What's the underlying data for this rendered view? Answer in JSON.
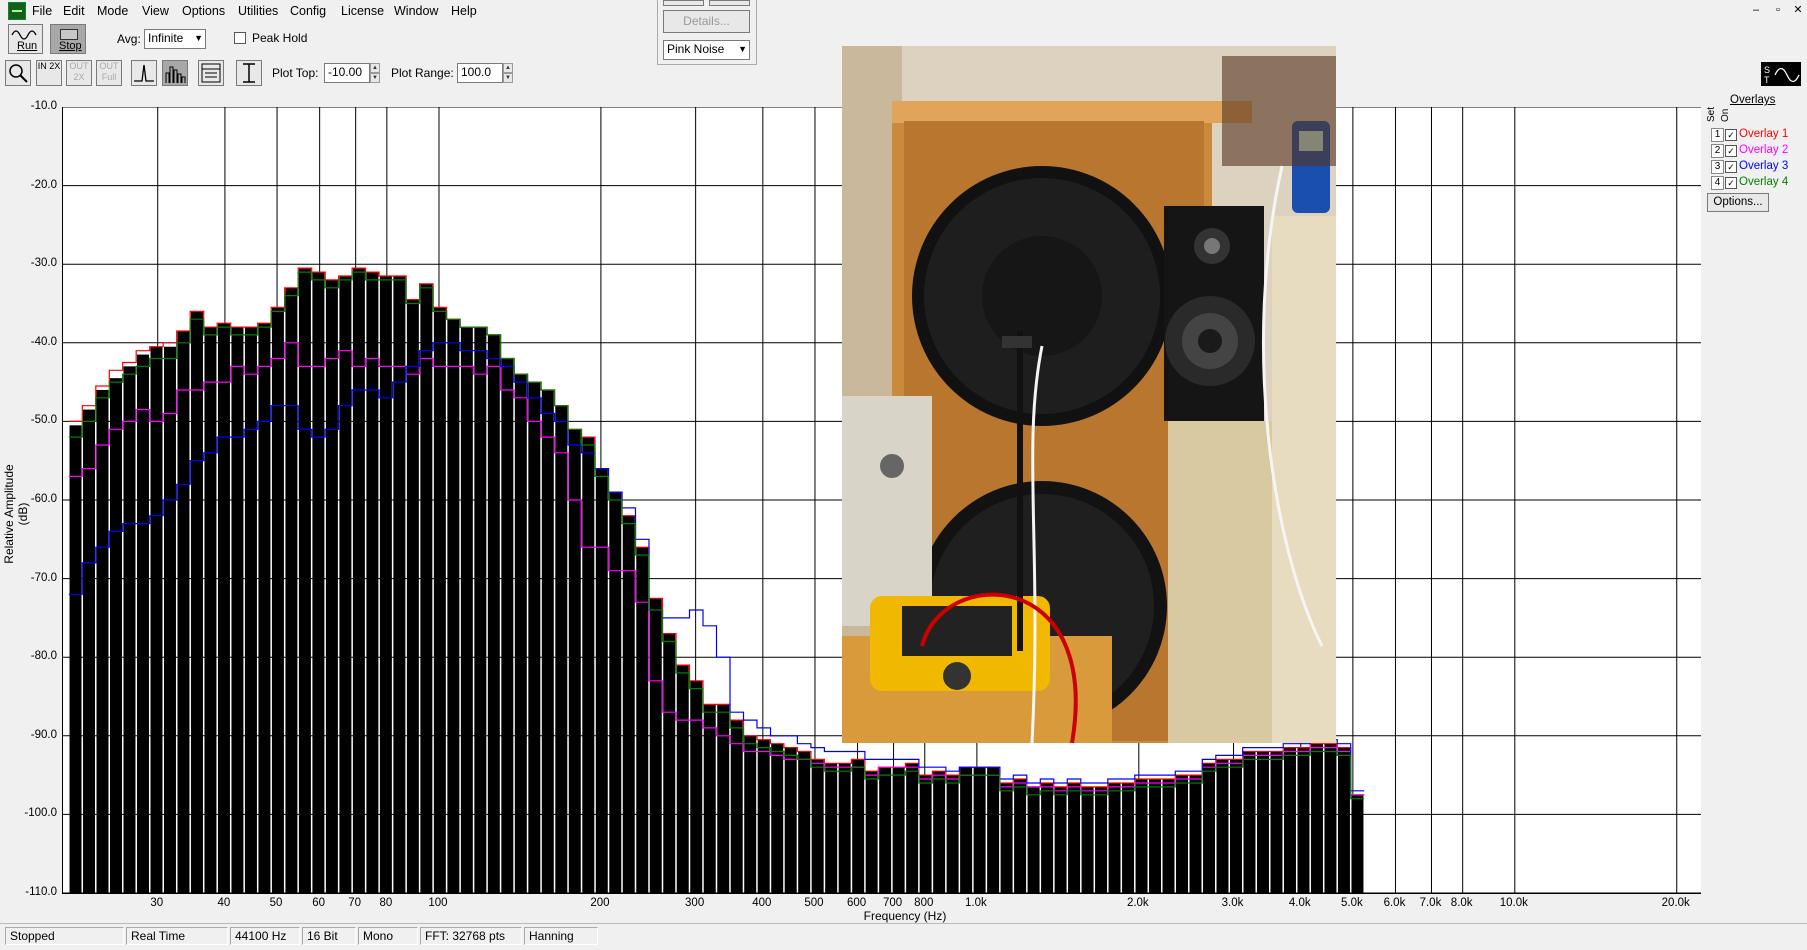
{
  "menu": [
    "File",
    "Edit",
    "Mode",
    "View",
    "Options",
    "Utilities",
    "Config",
    "License",
    "Window",
    "Help"
  ],
  "window_controls": [
    "–",
    "▫",
    "✕"
  ],
  "toolbar": {
    "run_label": "Run",
    "stop_label": "Stop",
    "avg_label": "Avg:",
    "avg_value": "Infinite",
    "peak_hold_label": "Peak Hold",
    "plot_top_label": "Plot Top:",
    "plot_top_value": "-10.00",
    "plot_range_label": "Plot Range:",
    "plot_range_value": "100.0",
    "details_label": "Details...",
    "generator_value": "Pink Noise",
    "zoom_buttons": [
      "IN 2X",
      "OUT 2X",
      "OUT Full"
    ]
  },
  "overlays": {
    "header": "Overlays",
    "set_label": "Set",
    "on_label": "On",
    "options_label": "Options...",
    "items": [
      {
        "num": "1",
        "name": "Overlay 1",
        "color": "#ff0000"
      },
      {
        "num": "2",
        "name": "Overlay 2",
        "color": "#ff00ff"
      },
      {
        "num": "3",
        "name": "Overlay 3",
        "color": "#0000ff"
      },
      {
        "num": "4",
        "name": "Overlay 4",
        "color": "#008000"
      }
    ]
  },
  "status": [
    "Stopped",
    "Real Time",
    "44100 Hz",
    "16 Bit",
    "Mono",
    "FFT: 32768 pts",
    "Hanning"
  ],
  "chart_data": {
    "type": "bar",
    "xlabel": "Frequency (Hz)",
    "ylabel": "Relative Amplitude (dB)",
    "ylim": [
      -110,
      -10
    ],
    "y_ticks": [
      "-10.0",
      "-20.0",
      "-30.0",
      "-40.0",
      "-50.0",
      "-60.0",
      "-70.0",
      "-80.0",
      "-90.0",
      "-100.0",
      "-110.0"
    ],
    "x_scale": "log",
    "x_ticks": [
      {
        "v": 30,
        "label": "30"
      },
      {
        "v": 40,
        "label": "40"
      },
      {
        "v": 50,
        "label": "50"
      },
      {
        "v": 60,
        "label": "60"
      },
      {
        "v": 70,
        "label": "70"
      },
      {
        "v": 80,
        "label": "80"
      },
      {
        "v": 100,
        "label": "100"
      },
      {
        "v": 200,
        "label": "200"
      },
      {
        "v": 300,
        "label": "300"
      },
      {
        "v": 400,
        "label": "400"
      },
      {
        "v": 500,
        "label": "500"
      },
      {
        "v": 600,
        "label": "600"
      },
      {
        "v": 700,
        "label": "700"
      },
      {
        "v": 800,
        "label": "800"
      },
      {
        "v": 1000,
        "label": "1.0k"
      },
      {
        "v": 2000,
        "label": "2.0k"
      },
      {
        "v": 3000,
        "label": "3.0k"
      },
      {
        "v": 4000,
        "label": "4.0k"
      },
      {
        "v": 5000,
        "label": "5.0k"
      },
      {
        "v": 6000,
        "label": "6.0k"
      },
      {
        "v": 7000,
        "label": "7.0k"
      },
      {
        "v": 8000,
        "label": "8.0k"
      },
      {
        "v": 10000,
        "label": "10.0k"
      },
      {
        "v": 20000,
        "label": "20.0k"
      }
    ],
    "grid": true,
    "bands_per_octave": 12,
    "bars_start_hz": 20.5,
    "values": [
      -50.5,
      -48.5,
      -46,
      -44.5,
      -43,
      -41.5,
      -40.5,
      -40.5,
      -38.5,
      -36,
      -38,
      -37.5,
      -38,
      -38,
      -37.5,
      -35.5,
      -33,
      -30.5,
      -31,
      -32,
      -31.5,
      -30.5,
      -31,
      -31.5,
      -31.5,
      -34.5,
      -32.5,
      -35.5,
      -37,
      -38,
      -38,
      -39,
      -42,
      -44,
      -45,
      -46,
      -48,
      -51,
      -52,
      -56,
      -59,
      -62,
      -66,
      -72.5,
      -77,
      -81,
      -83,
      -86,
      -86,
      -88,
      -90,
      -90.5,
      -91,
      -91.5,
      -92,
      -93,
      -93.5,
      -93.5,
      -93,
      -94.5,
      -94,
      -94,
      -93.5,
      -95,
      -94.5,
      -95,
      -94,
      -94,
      -94,
      -96,
      -95.5,
      -96.5,
      -96,
      -96.5,
      -96,
      -96.5,
      -96.5,
      -96,
      -96,
      -95.5,
      -95.5,
      -95.5,
      -95,
      -95,
      -93.5,
      -93,
      -93,
      -92,
      -92,
      -92,
      -91.5,
      -91.5,
      -91,
      -91,
      -91.5,
      -97.5
    ],
    "series": [
      {
        "name": "Overlay 1",
        "color": "#ff0000",
        "values": [
          -50,
          -48,
          -45.5,
          -43.5,
          -42.5,
          -41,
          -40.5,
          -40,
          -38.5,
          -36,
          -38,
          -37.5,
          -38,
          -38,
          -37.5,
          -35.5,
          -33,
          -30.5,
          -31,
          -32,
          -31.5,
          -30.5,
          -31,
          -31.5,
          -31.5,
          -34.5,
          -32.5,
          -35.5,
          -37,
          -38,
          -38,
          -39,
          -42,
          -44,
          -45,
          -46,
          -48,
          -51,
          -52,
          -56,
          -59,
          -62,
          -66,
          -72.5,
          -77,
          -81,
          -83,
          -86,
          -86,
          -88,
          -90,
          -90.5,
          -91,
          -91.5,
          -92,
          -93,
          -93.5,
          -93.5,
          -93,
          -94.5,
          -94,
          -94,
          -93.5,
          -95,
          -94.5,
          -95,
          -94,
          -94,
          -94,
          -96,
          -95.5,
          -96.5,
          -96,
          -96.5,
          -96,
          -96.5,
          -96.5,
          -96,
          -96,
          -95.5,
          -95.5,
          -95.5,
          -95,
          -95,
          -93.5,
          -93,
          -93,
          -92,
          -92,
          -92,
          -91.5,
          -91.5,
          -91,
          -91,
          -91.5,
          -97.5
        ]
      },
      {
        "name": "Overlay 2",
        "color": "#ff00ff",
        "values": [
          -57,
          -56,
          -53,
          -51,
          -50,
          -48.5,
          -50,
          -49,
          -46,
          -46,
          -45,
          -45,
          -43,
          -44,
          -43,
          -42,
          -40,
          -43,
          -43,
          -42,
          -41,
          -43,
          -42,
          -43,
          -43,
          -44,
          -42,
          -43,
          -43,
          -43,
          -44,
          -43,
          -46,
          -47,
          -50,
          -52,
          -54,
          -60,
          -66,
          -66,
          -69,
          -69,
          -73,
          -83,
          -87,
          -88,
          -88,
          -89,
          -90,
          -91,
          -92,
          -92,
          -92.5,
          -93,
          -93,
          -93.5,
          -94,
          -94,
          -94,
          -95,
          -94,
          -94,
          -94,
          -95.5,
          -95,
          -95.5,
          -95,
          -95,
          -95,
          -96.5,
          -96,
          -96.5,
          -96.5,
          -97,
          -96.5,
          -97,
          -97,
          -96.5,
          -96.5,
          -96,
          -96,
          -96,
          -95.5,
          -95.5,
          -94,
          -93.5,
          -93.5,
          -92.5,
          -92.5,
          -92.5,
          -92,
          -92,
          -91.5,
          -91.5,
          -92,
          -97.5
        ]
      },
      {
        "name": "Overlay 3",
        "color": "#0000ff",
        "values": [
          -72,
          -68,
          -66,
          -64,
          -63,
          -63,
          -62,
          -60,
          -58,
          -55,
          -54,
          -52,
          -52,
          -51,
          -50,
          -48,
          -48,
          -51,
          -52,
          -51,
          -48,
          -46,
          -46,
          -47,
          -45,
          -43,
          -41,
          -40,
          -40,
          -41,
          -41,
          -42,
          -43,
          -45,
          -47,
          -49,
          -50,
          -53,
          -54,
          -56,
          -59,
          -61,
          -65,
          -74,
          -75,
          -75,
          -74,
          -76,
          -80,
          -87,
          -88,
          -89,
          -90,
          -90,
          -91,
          -91.5,
          -92,
          -92,
          -92,
          -93,
          -93,
          -93,
          -93,
          -94,
          -94,
          -94.5,
          -94,
          -94,
          -94,
          -95.5,
          -95,
          -96,
          -95.5,
          -96,
          -95.5,
          -96,
          -96,
          -95.5,
          -95.5,
          -95,
          -95,
          -95,
          -94.5,
          -94.5,
          -93,
          -92.5,
          -92.5,
          -91.5,
          -91.5,
          -91.5,
          -91,
          -91,
          -90.5,
          -90.5,
          -91,
          -97
        ]
      },
      {
        "name": "Overlay 4",
        "color": "#008000",
        "values": [
          -52,
          -50,
          -47,
          -45,
          -44,
          -43,
          -42,
          -42,
          -40,
          -37,
          -39,
          -38,
          -39,
          -39,
          -38,
          -36,
          -34,
          -31,
          -32,
          -33,
          -32,
          -31,
          -32,
          -32,
          -32,
          -35,
          -33,
          -36,
          -37,
          -38,
          -38,
          -39,
          -42,
          -44,
          -45,
          -46,
          -48,
          -51,
          -53,
          -57,
          -60,
          -63,
          -67,
          -74,
          -78,
          -82,
          -84,
          -87,
          -87,
          -89,
          -91,
          -91.5,
          -92,
          -92.5,
          -93,
          -94,
          -94.5,
          -94.5,
          -94,
          -95.5,
          -95,
          -95,
          -94.5,
          -96,
          -95.5,
          -96,
          -95,
          -95,
          -95,
          -97,
          -96.5,
          -97.5,
          -97,
          -97.5,
          -97,
          -97.5,
          -97.5,
          -97,
          -97,
          -96.5,
          -96.5,
          -96.5,
          -96,
          -96,
          -94.5,
          -94,
          -94,
          -93,
          -93,
          -93,
          -92.5,
          -92.5,
          -92,
          -92,
          -92.5,
          -98
        ]
      }
    ]
  }
}
